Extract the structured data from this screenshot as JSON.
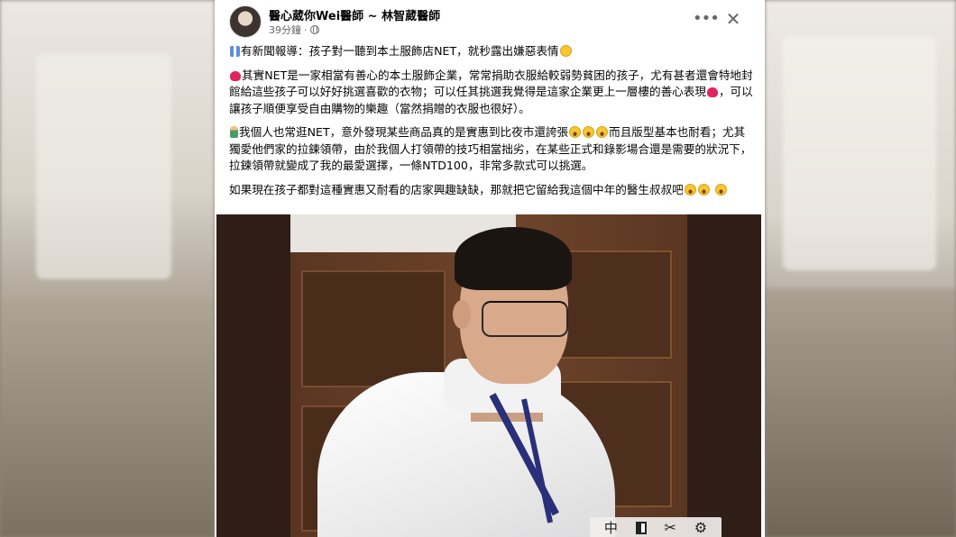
{
  "post": {
    "author": "醫心葳你Wei醫師 ~ 林智葳醫師",
    "time": "39分鐘",
    "separator": "·",
    "menu_icon": "more-dots-icon",
    "close_icon": "close-icon",
    "paragraphs": {
      "p1": "有新聞報導：孩子對一聽到本土服飾店NET，就秒露出嫌惡表情",
      "p2a": "其實NET是一家相當有善心的本土服飾企業，常常捐助衣服給較弱勢貧困的孩子，尤有甚者還會特地封館給這些孩子可以好好挑選喜歡的衣物；可以任其挑選我覺得是這家企業更上一層樓的善心表現",
      "p2b": "，可以讓孩子順便享受自由購物的樂趣（當然捐贈的衣服也很好）。",
      "p3a": "我個人也常逛NET，意外發現某些商品真的是實惠到比夜市還誇張",
      "p3b": "而且版型基本也耐看；尤其獨愛他們家的拉鍊領帶，由於我個人打領帶的技巧相當拙劣，在某些正式和錄影場合還是需要的狀況下，拉鍊領帶就變成了我的最愛選擇，一條NTD100，非常多款式可以挑選。",
      "p4": "如果現在孩子都對這種實惠又耐看的店家興趣缺缺，那就把它留給我這個中年的醫生叔叔吧"
    }
  },
  "image_toolbar": {
    "translate_label": "中",
    "buttons": [
      "translate-icon",
      "contrast-icon",
      "scissors-icon",
      "gear-icon"
    ]
  }
}
